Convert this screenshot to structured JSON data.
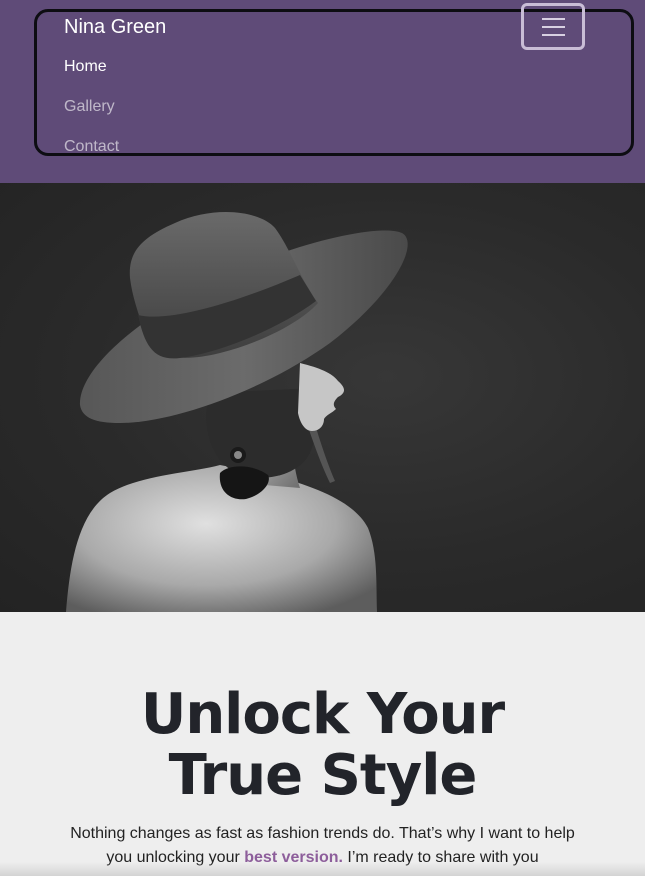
{
  "navbar": {
    "brand": "Nina Green",
    "toggler_icon": "hamburger-menu-icon",
    "links": [
      {
        "label": "Home",
        "active": true
      },
      {
        "label": "Gallery",
        "active": false
      },
      {
        "label": "Contact",
        "active": false
      }
    ],
    "background_color": "#5f4b78"
  },
  "hero": {
    "image": "woman-in-black-hat-photo"
  },
  "main": {
    "headline_line1": "Unlock Your",
    "headline_line2": "True Style",
    "intro_before": "Nothing changes as fast as fashion trends do. That’s why I want to help you unlocking your ",
    "intro_highlight": "best version.",
    "intro_after": " I’m ready to share with you",
    "accent_color": "#8d5e9b"
  }
}
